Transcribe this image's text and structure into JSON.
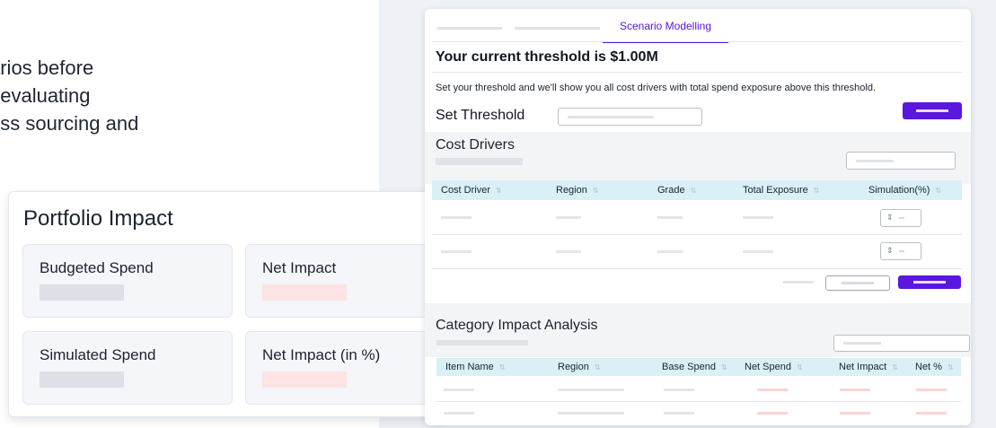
{
  "intro": {
    "line1": "arios before",
    "line2": ", evaluating",
    "line3": "oss sourcing and"
  },
  "portfolio": {
    "title": "Portfolio Impact",
    "cells": [
      {
        "label": "Budgeted Spend"
      },
      {
        "label": "Net Impact"
      },
      {
        "label": "Simulated Spend"
      },
      {
        "label": "Net Impact (in %)"
      }
    ]
  },
  "panel": {
    "active_tab": "Scenario Modelling",
    "title": "Your current threshold is $1.00M",
    "description": "Set your threshold and we'll show you all cost drivers with total spend exposure above this threshold.",
    "set_threshold_label": "Set Threshold",
    "cost_drivers": {
      "title": "Cost Drivers",
      "columns": [
        "Cost Driver",
        "Region",
        "Grade",
        "Total Exposure",
        "Simulation(%)"
      ],
      "stepper_icon": "stepper-icon"
    },
    "category": {
      "title": "Category Impact Analysis",
      "columns": [
        "Item Name",
        "Region",
        "Base Spend",
        "Net Spend",
        "Net Impact",
        "Net %"
      ]
    }
  },
  "colors": {
    "accent": "#5b16e0",
    "table_header": "#d8f0f6",
    "negative": "#fbd5d5"
  }
}
